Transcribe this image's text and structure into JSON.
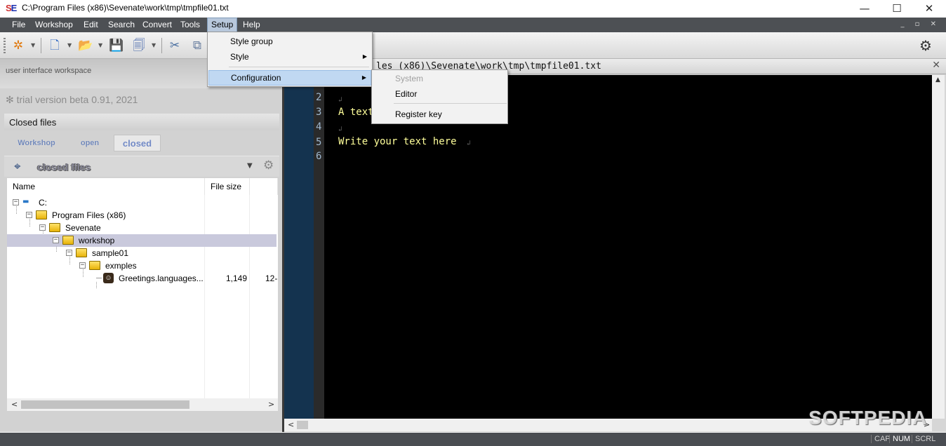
{
  "window": {
    "title": "C:\\Program Files (x86)\\Sevenate\\work\\tmp\\tmpfile01.txt",
    "logo": "SE",
    "minimize": "—",
    "maximize": "☐",
    "close": "✕"
  },
  "menubar": {
    "items": [
      "File",
      "Workshop",
      "Edit",
      "Search",
      "Convert",
      "Tools",
      "Setup",
      "Help"
    ],
    "active": "Setup",
    "mdi_controls": "_ ▫ ✕"
  },
  "setup_menu": {
    "items": [
      "Style group",
      "Style",
      "Configuration"
    ],
    "highlighted": "Configuration"
  },
  "config_menu": {
    "items": [
      "System",
      "Editor",
      "Register key"
    ],
    "disabled": [
      "System"
    ]
  },
  "left_panel": {
    "workspace_label": "user interface workspace",
    "trial_text": "✻ trial version beta 0.91, 2021",
    "section_title": "Closed files",
    "tabs": [
      "Workshop",
      "open",
      "closed"
    ],
    "selected_tab": "closed",
    "panel_title": "closed files",
    "columns": [
      "Name",
      "File size"
    ],
    "tree": [
      {
        "name": "C:",
        "level": 0,
        "type": "drive"
      },
      {
        "name": "Program Files (x86)",
        "level": 1,
        "type": "folder"
      },
      {
        "name": "Sevenate",
        "level": 2,
        "type": "folder"
      },
      {
        "name": "workshop",
        "level": 3,
        "type": "folder",
        "selected": true
      },
      {
        "name": "sample01",
        "level": 4,
        "type": "folder"
      },
      {
        "name": "exmples",
        "level": 5,
        "type": "folder"
      },
      {
        "name": "Greetings.languages...",
        "level": 6,
        "type": "file",
        "size": "1,149",
        "date": "12-"
      }
    ]
  },
  "editor": {
    "path_text": "les (x86)\\Sevenate\\work\\tmp\\tmpfile01.txt",
    "lines": [
      {
        "num": "2",
        "text": ""
      },
      {
        "num": "3",
        "text": "A text"
      },
      {
        "num": "4",
        "text": ""
      },
      {
        "num": "5",
        "text": "Write your text here"
      },
      {
        "num": "6",
        "text": ""
      }
    ],
    "eol_mark": "↲",
    "background": "#000000",
    "text_color": "#ffff9a"
  },
  "watermark": "SOFTPEDIA",
  "statusbar": {
    "indicators": [
      "CAP",
      "NUM",
      "SCRL"
    ],
    "active": [
      "NUM"
    ]
  }
}
